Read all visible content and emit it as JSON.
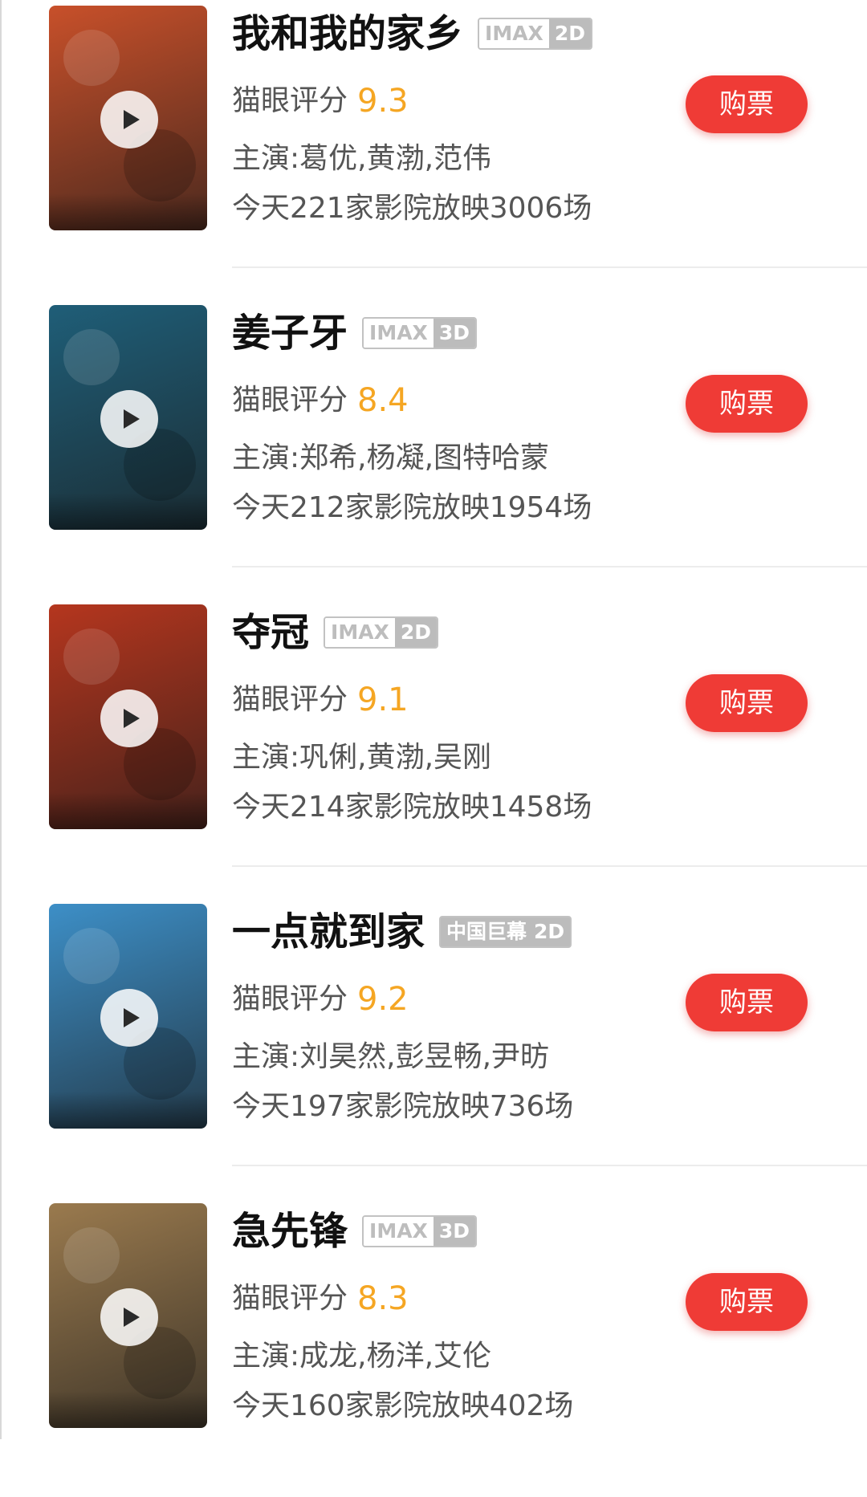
{
  "movies": [
    {
      "title": "我和我的家乡",
      "tag_left": "IMAX",
      "tag_right": "2D",
      "tag_style": "outline",
      "score_label": "猫眼评分",
      "score": "9.3",
      "cast": "主演:葛优,黄渤,范伟",
      "showing": "今天221家影院放映3006场",
      "buy_label": "购票",
      "poster_color": "#c8502a"
    },
    {
      "title": "姜子牙",
      "tag_left": "IMAX",
      "tag_right": "3D",
      "tag_style": "outline",
      "score_label": "猫眼评分",
      "score": "8.4",
      "cast": "主演:郑希,杨凝,图特哈蒙",
      "showing": "今天212家影院放映1954场",
      "buy_label": "购票",
      "poster_color": "#1f5e78"
    },
    {
      "title": "夺冠",
      "tag_left": "IMAX",
      "tag_right": "2D",
      "tag_style": "outline",
      "score_label": "猫眼评分",
      "score": "9.1",
      "cast": "主演:巩俐,黄渤,吴刚",
      "showing": "今天214家影院放映1458场",
      "buy_label": "购票",
      "poster_color": "#b5361e"
    },
    {
      "title": "一点就到家",
      "tag_left": "中国巨幕",
      "tag_right": "2D",
      "tag_style": "solid",
      "score_label": "猫眼评分",
      "score": "9.2",
      "cast": "主演:刘昊然,彭昱畅,尹昉",
      "showing": "今天197家影院放映736场",
      "buy_label": "购票",
      "poster_color": "#3d8fc7"
    },
    {
      "title": "急先锋",
      "tag_left": "IMAX",
      "tag_right": "3D",
      "tag_style": "outline",
      "score_label": "猫眼评分",
      "score": "8.3",
      "cast": "主演:成龙,杨洋,艾伦",
      "showing": "今天160家影院放映402场",
      "buy_label": "购票",
      "poster_color": "#9a7a4e"
    }
  ]
}
